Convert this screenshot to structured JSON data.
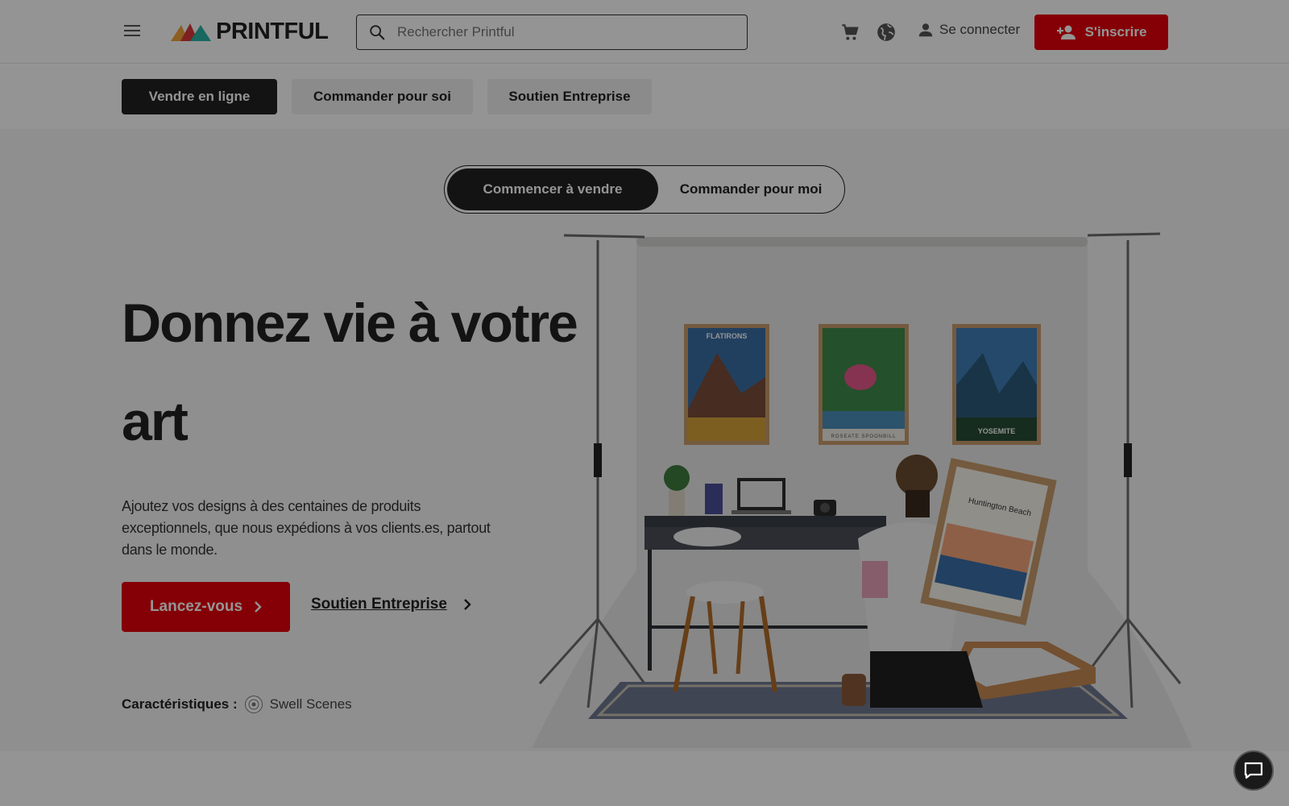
{
  "header": {
    "brand": "PRINTFUL",
    "search": {
      "placeholder": "Rechercher Printful",
      "value": ""
    },
    "signin_label": "Se connecter",
    "signup_label": "S'inscrire",
    "icons": [
      "menu-icon",
      "cart-icon",
      "globe-icon",
      "user-icon",
      "add-user-icon",
      "search-icon"
    ]
  },
  "subnav": {
    "items": [
      {
        "label": "Vendre en ligne",
        "active": true
      },
      {
        "label": "Commander pour soi",
        "active": false
      },
      {
        "label": "Soutien Entreprise",
        "active": false
      }
    ]
  },
  "hero": {
    "toggle": {
      "option_on": "Commencer à vendre",
      "option_off": "Commander pour moi"
    },
    "headline_line1": "Donnez vie à votre",
    "headline_line2": "art",
    "description": "Ajoutez vos designs à des centaines de produits exceptionnels, que nous expédions à vos clients.es, partout dans le monde.",
    "cta_label": "Lancez-vous",
    "link_label": "Soutien Entreprise",
    "features_label": "Caractéristiques :",
    "features_name": "Swell Scenes",
    "posters": [
      "FLATIRONS",
      "ROSEATE SPOONBILL",
      "YOSEMITE",
      "Huntington Beach"
    ]
  },
  "colors": {
    "accent": "#e3000b",
    "dark": "#222222"
  }
}
